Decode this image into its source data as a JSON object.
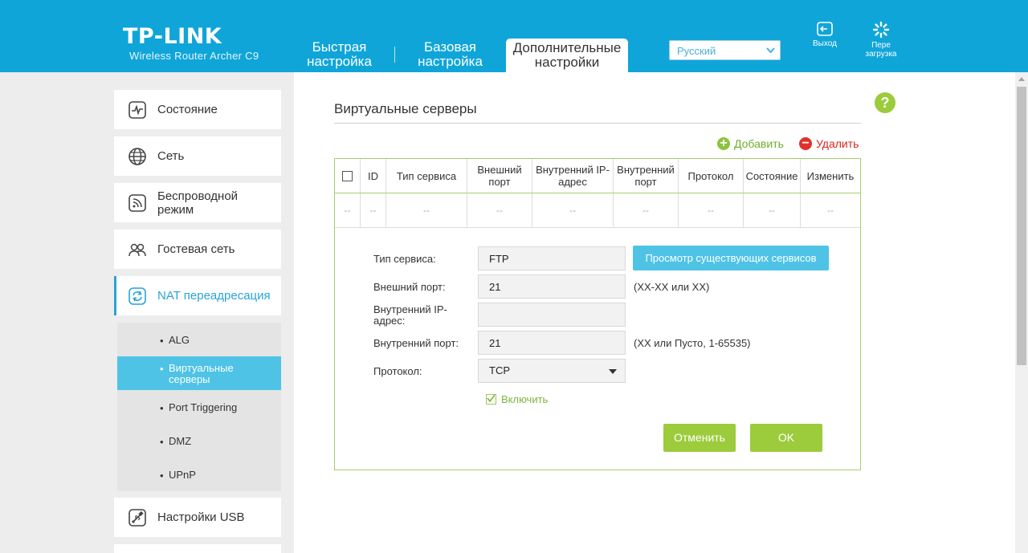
{
  "header": {
    "logo": "TP-LINK",
    "model": "Wireless Router Archer C9",
    "tabs": [
      "Быстрая\nнастройка",
      "Базовая\nнастройка",
      "Дополнительные\nнастройки"
    ],
    "language": "Русский",
    "logout": "Выход",
    "reboot": [
      "Пере",
      "загрузка"
    ]
  },
  "sidebar": {
    "items": [
      {
        "label": "Состояние",
        "icon": "status-icon"
      },
      {
        "label": "Сеть",
        "icon": "globe-icon"
      },
      {
        "label": "Беспроводной режим",
        "icon": "wireless-icon"
      },
      {
        "label": "Гостевая сеть",
        "icon": "guest-network-icon"
      },
      {
        "label": "NAT переадресация",
        "icon": "nat-icon"
      },
      {
        "label": "Настройки USB",
        "icon": "usb-icon"
      }
    ],
    "sub_items": [
      "ALG",
      "Виртуальные серверы",
      "Port Triggering",
      "DMZ",
      "UPnP"
    ]
  },
  "main": {
    "title": "Виртуальные серверы",
    "add": "Добавить",
    "delete": "Удалить",
    "columns": [
      "ID",
      "Тип сервиса",
      "Внешний порт",
      "Внутренний IP-адрес",
      "Внутренний порт",
      "Протокол",
      "Состояние",
      "Изменить"
    ],
    "empty_cell": "--",
    "form": {
      "service_type_label": "Тип сервиса:",
      "service_type_value": "FTP",
      "view_services_button": "Просмотр существующих сервисов",
      "external_port_label": "Внешний порт:",
      "external_port_value": "21",
      "external_port_hint": "(XX-XX или XX)",
      "internal_ip_label": "Внутренний IP-адрес:",
      "internal_ip_value": "",
      "internal_port_label": "Внутренний порт:",
      "internal_port_value": "21",
      "internal_port_hint": "(XX или Пусто, 1-65535)",
      "protocol_label": "Протокол:",
      "protocol_value": "TCP",
      "enable_label": "Включить",
      "cancel": "Отменить",
      "ok": "OK"
    }
  },
  "colors": {
    "header": "#0fa5d9",
    "accent_green": "#9ccb3c",
    "accent_blue": "#4ec3e6",
    "delete_red": "#e0312b"
  }
}
